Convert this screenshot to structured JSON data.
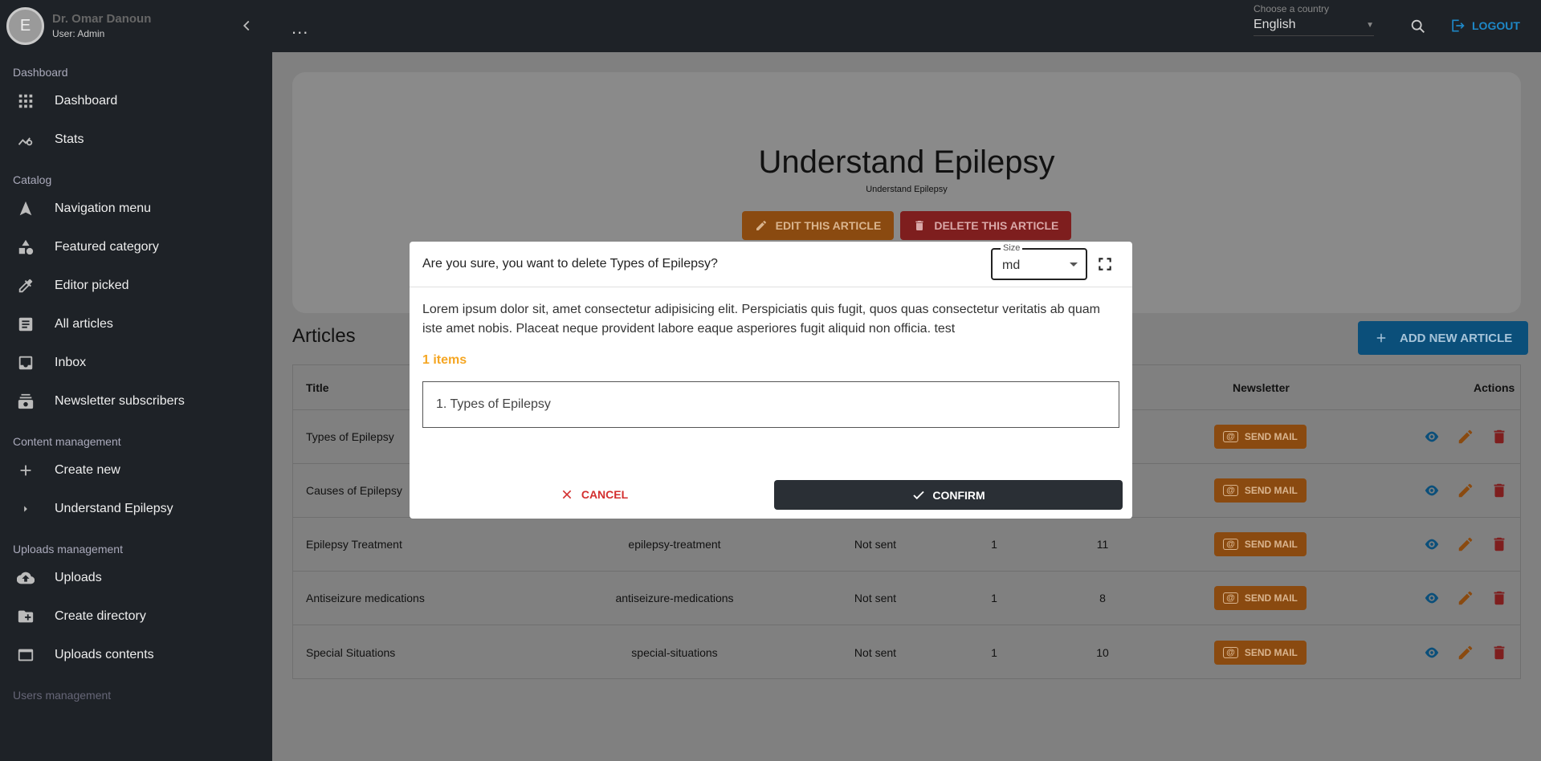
{
  "user": {
    "initial": "E",
    "name": "Dr. Omar Danoun",
    "role": "User: Admin"
  },
  "sidebar": {
    "sections": [
      {
        "label": "Dashboard",
        "items": [
          {
            "label": "Dashboard",
            "icon": "grid-icon"
          },
          {
            "label": "Stats",
            "icon": "stats-icon"
          }
        ]
      },
      {
        "label": "Catalog",
        "items": [
          {
            "label": "Navigation menu",
            "icon": "navigation-icon"
          },
          {
            "label": "Featured category",
            "icon": "category-icon"
          },
          {
            "label": "Editor picked",
            "icon": "editor-pick-icon"
          },
          {
            "label": "All articles",
            "icon": "article-icon"
          },
          {
            "label": "Inbox",
            "icon": "inbox-icon"
          },
          {
            "label": "Newsletter subscribers",
            "icon": "subscribers-icon"
          }
        ]
      },
      {
        "label": "Content management",
        "items": [
          {
            "label": "Create new",
            "icon": "plus-icon"
          },
          {
            "label": "Understand Epilepsy",
            "icon": "chevron-right-icon"
          }
        ]
      },
      {
        "label": "Uploads management",
        "items": [
          {
            "label": "Uploads",
            "icon": "cloud-upload-icon"
          },
          {
            "label": "Create directory",
            "icon": "folder-add-icon"
          },
          {
            "label": "Uploads contents",
            "icon": "window-icon"
          }
        ]
      },
      {
        "label": "Users management",
        "items": []
      }
    ]
  },
  "topbar": {
    "more": "...",
    "country_label": "Choose a country",
    "country_value": "English",
    "logout": "LOGOUT"
  },
  "hero": {
    "title": "Understand Epilepsy",
    "subtitle": "Understand Epilepsy",
    "edit_label": "EDIT THIS ARTICLE",
    "delete_label": "DELETE THIS ARTICLE"
  },
  "articles": {
    "title": "Articles",
    "add_label": "ADD NEW ARTICLE",
    "columns": {
      "title": "Title",
      "newsletter": "Newsletter",
      "actions": "Actions"
    },
    "send_label": "SEND MAIL",
    "rows": [
      {
        "title": "Types of Epilepsy",
        "slug": "",
        "status": "",
        "a": "",
        "b": ""
      },
      {
        "title": "Causes of Epilepsy",
        "slug": "",
        "status": "",
        "a": "",
        "b": ""
      },
      {
        "title": "Epilepsy Treatment",
        "slug": "epilepsy-treatment",
        "status": "Not sent",
        "a": "1",
        "b": "11"
      },
      {
        "title": "Antiseizure medications",
        "slug": "antiseizure-medications",
        "status": "Not sent",
        "a": "1",
        "b": "8"
      },
      {
        "title": "Special Situations",
        "slug": "special-situations",
        "status": "Not sent",
        "a": "1",
        "b": "10"
      }
    ]
  },
  "modal": {
    "title": "Are you sure, you want to delete Types of Epilepsy?",
    "size_label": "Size",
    "size_value": "md",
    "text": "Lorem ipsum dolor sit, amet consectetur adipisicing elit. Perspiciatis quis fugit, quos quas consectetur veritatis ab quam iste amet nobis. Placeat neque provident labore eaque asperiores fugit aliquid non officia. test",
    "items_count": "1 items",
    "items": [
      "1. Types of Epilepsy"
    ],
    "cancel": "CANCEL",
    "confirm": "CONFIRM"
  },
  "colors": {
    "accent": "#1e88c7",
    "warning": "#f5a623",
    "danger": "#d32f2f",
    "dark": "#1e2227"
  }
}
